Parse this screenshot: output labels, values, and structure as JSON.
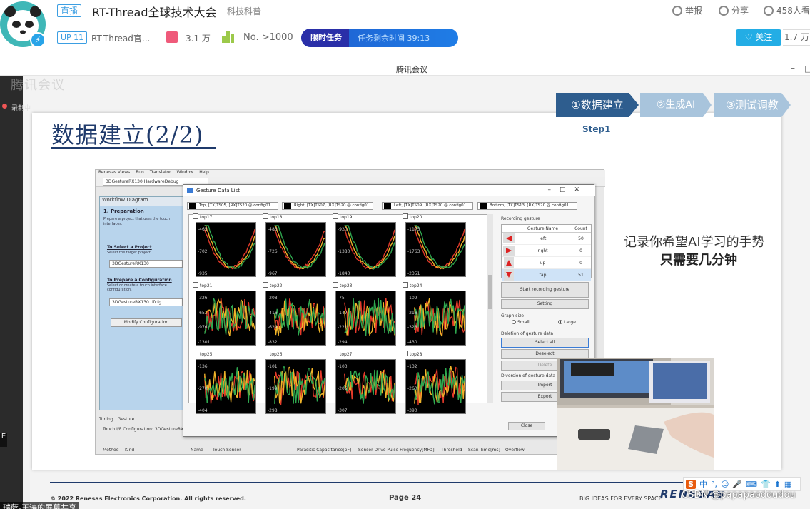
{
  "header": {
    "live_badge": "直播",
    "room_title": "RT-Thread全球技术大会",
    "category": "科技科普",
    "report": "举报",
    "share": "分享",
    "viewers": "458人看",
    "up_badge": "UP 11",
    "streamer_name": "RT-Thread官...",
    "gift_count": "3.1 万",
    "rank": "No. >1000",
    "task_label": "限时任务",
    "task_remaining": "任务剩余时间 39:13",
    "follow": "关注",
    "follow_count": "1.7 万"
  },
  "meeting": {
    "title": "腾讯会议",
    "min": "–",
    "max": "□"
  },
  "side": {
    "ghost_text": "腾讯会议",
    "record_label": "录制中",
    "num": "E",
    "bottom_caption": "瑞萨-王涛的屏幕共享"
  },
  "slide": {
    "title": "数据建立(2/2)",
    "steps": [
      "①数据建立",
      "②生成AI",
      "③测试调教"
    ],
    "step_caption": "Step1",
    "text_line_1": "记录你希望AI学习的手势",
    "text_line_2": "只需要几分钟",
    "copyright": "© 2022 Renesas Electronics Corporation. All rights reserved.",
    "page": "Page 24",
    "tagline": "BIG IDEAS FOR EVERY SPACE",
    "logo": "RENESAS",
    "watermark": "CSDN @papapaodoudou"
  },
  "ime": {
    "s": "S",
    "items": [
      "中",
      "°,",
      "☺",
      "🎤",
      "⌨",
      "👕",
      "⬆",
      "▦"
    ]
  },
  "ide": {
    "menu": [
      "Renesas Views",
      "Run",
      "Translator",
      "Window",
      "Help"
    ],
    "project_select": "3DGestureRX130 HardwareDebug",
    "workflow_title": "Workflow Diagram",
    "prep_title": "1. Preparation",
    "prep_desc_1": "Prepare a project that uses the touch",
    "prep_desc_2": "interfaces.",
    "select_project_head": "To Select a Project",
    "select_project_desc": "Select the target project.",
    "project_value": "3DGestureRX130",
    "prepare_config_head": "To Prepare a Configuration",
    "prepare_config_desc_1": "Select or create a touch interface",
    "prepare_config_desc_2": "configuration.",
    "config_value": "3DGestureRX130.tifcfg",
    "modify_button": "Modify Configuration",
    "bottom_tabs": [
      "Tuning",
      "Gesture"
    ],
    "touch_config": "Touch I/F Configuration: 3DGestureRX130",
    "table_columns": [
      "Method",
      "Kind",
      "Name",
      "Touch Sensor",
      "Parasitic Capacitance[pF]",
      "Sensor Drive Pulse Frequency[MHz]",
      "Threshold",
      "Scan Time[ms]",
      "Overflow"
    ]
  },
  "dialog": {
    "title": "Gesture Data List",
    "configs": [
      "Top, [TX]TS05, [RX]TS20 @ config01",
      "Right, [TX]TS07, [RX]TS20 @ config01",
      "Left, [TX]TS09, [RX]TS20 @ config01",
      "Bottom, [TX]TS13, [RX]TS20 @ config01"
    ],
    "row_labels": [
      [
        "top17",
        "top18",
        "top19",
        "top20"
      ],
      [
        "top21",
        "top22",
        "top23",
        "top24"
      ],
      [
        "top25",
        "top26",
        "top27",
        "top28"
      ]
    ],
    "thumb_ticks": [
      [
        [
          "-465",
          "-702",
          "-935"
        ],
        [
          "-485",
          "-726",
          "-967"
        ],
        [
          "-920",
          "-1380",
          "-1840"
        ],
        [
          "-1175",
          "-1763",
          "-2351"
        ]
      ],
      [
        [
          "-326",
          "-651",
          "-976",
          "-1301"
        ],
        [
          "-208",
          "-416",
          "-624",
          "-832"
        ],
        [
          "-75",
          "-147",
          "-221",
          "-294"
        ],
        [
          "-109",
          "-216",
          "-323",
          "-430"
        ]
      ],
      [
        [
          "-136",
          "-270",
          "-404"
        ],
        [
          "-101",
          "-199",
          "-298"
        ],
        [
          "-103",
          "-205",
          "-307"
        ],
        [
          "-132",
          "-260",
          "-390"
        ]
      ]
    ],
    "recording_title": "Recording gesture",
    "rec_head_name": "Gesture Name",
    "rec_head_count": "Count",
    "recordings": [
      {
        "name": "left",
        "count": "50"
      },
      {
        "name": "right",
        "count": "0"
      },
      {
        "name": "up",
        "count": "0"
      },
      {
        "name": "tap",
        "count": "51"
      }
    ],
    "start_recording": "Start recording gesture",
    "setting": "Setting",
    "graph_size": "Graph size",
    "small": "Small",
    "large": "Large",
    "deletion": "Deletion of gesture data",
    "select_all": "Select all",
    "deselect": "Deselect",
    "delete": "Delete",
    "diversion": "Diversion of gesture data",
    "import": "Import",
    "export": "Export",
    "close": "Close"
  }
}
